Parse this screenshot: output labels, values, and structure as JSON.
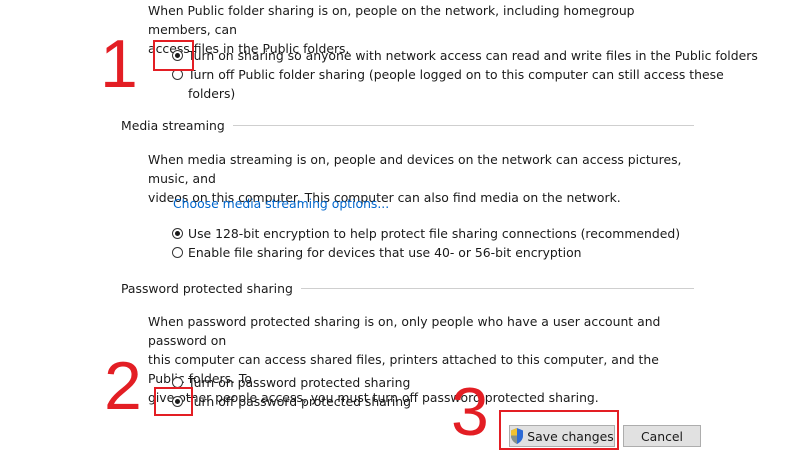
{
  "public_folder": {
    "description": "When Public folder sharing is on, people on the network, including homegroup members, can access files in the Public folders.",
    "description_line1": "When Public folder sharing is on, people on the network, including homegroup members, can",
    "description_line2": "access files in the Public folders.",
    "option_on": "Turn on sharing so anyone with network access can read and write files in the Public folders",
    "option_off_line1": "Turn off Public folder sharing (people logged on to this computer can still access these",
    "option_off_line2": "folders)",
    "selected": "on"
  },
  "media_streaming": {
    "heading": "Media streaming",
    "description_line1": "When media streaming is on, people and devices on the network can access pictures, music, and",
    "description_line2": "videos on this computer. This computer can also find media on the network.",
    "link": "Choose media streaming options...",
    "option_128": "Use 128-bit encryption to help protect file sharing connections (recommended)",
    "option_40_56": "Enable file sharing for devices that use 40- or 56-bit encryption",
    "selected": "128"
  },
  "password_sharing": {
    "heading": "Password protected sharing",
    "description_line1": "When password protected sharing is on, only people who have a user account and password on",
    "description_line2": "this computer can access shared files, printers attached to this computer, and the Public folders. To",
    "description_line3": "give other people access, you must turn off password protected sharing.",
    "option_on": "Turn on password protected sharing",
    "option_off": "Turn off password protected sharing",
    "selected": "off"
  },
  "buttons": {
    "save": "Save changes",
    "cancel": "Cancel"
  },
  "annotations": {
    "step1": "1",
    "step2": "2",
    "step3": "3",
    "color": "#e31e24"
  },
  "icons": {
    "save_button_icon": "uac-shield-icon"
  }
}
